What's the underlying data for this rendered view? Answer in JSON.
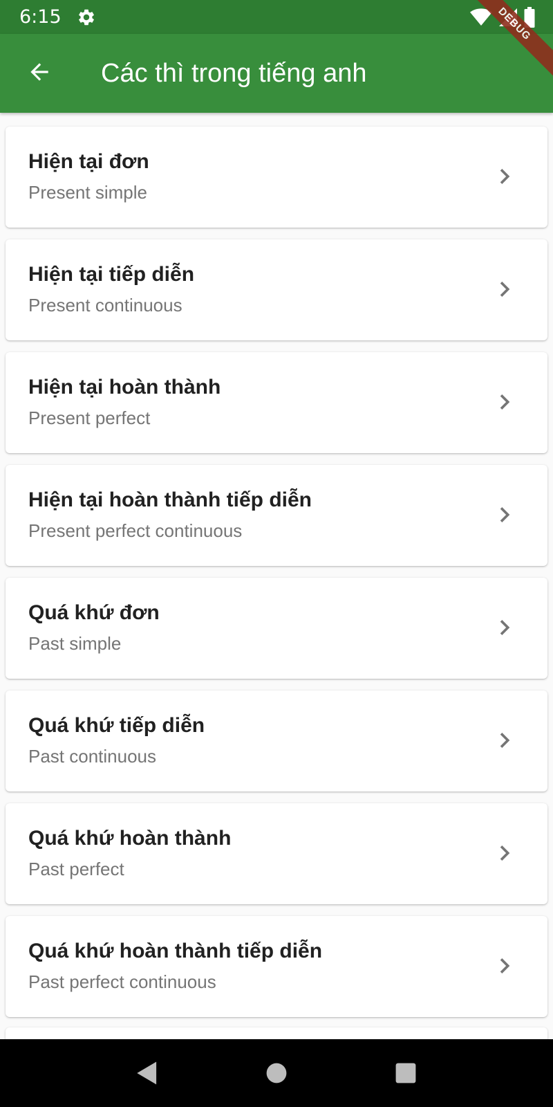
{
  "status_bar": {
    "time": "6:15",
    "icons": [
      "settings-gear-icon",
      "wifi-icon",
      "cell-signal-icon",
      "battery-icon"
    ]
  },
  "debug_banner": "DEBUG",
  "app_bar": {
    "title": "Các thì trong tiếng anh",
    "back_icon": "arrow-back-icon",
    "color": "#388e3c",
    "status_color": "#2e7d32"
  },
  "tenses": [
    {
      "title": "Hiện tại đơn",
      "subtitle": "Present simple"
    },
    {
      "title": "Hiện tại tiếp diễn",
      "subtitle": "Present continuous"
    },
    {
      "title": "Hiện tại hoàn thành",
      "subtitle": "Present perfect"
    },
    {
      "title": "Hiện tại hoàn thành tiếp diễn",
      "subtitle": "Present perfect continuous"
    },
    {
      "title": "Quá khứ đơn",
      "subtitle": "Past simple"
    },
    {
      "title": "Quá khứ tiếp diễn",
      "subtitle": "Past continuous"
    },
    {
      "title": "Quá khứ hoàn thành",
      "subtitle": "Past perfect"
    },
    {
      "title": "Quá khứ hoàn thành tiếp diễn",
      "subtitle": "Past perfect continuous"
    }
  ],
  "nav_bar": {
    "icons": [
      "back-triangle-icon",
      "home-circle-icon",
      "recents-square-icon"
    ]
  }
}
